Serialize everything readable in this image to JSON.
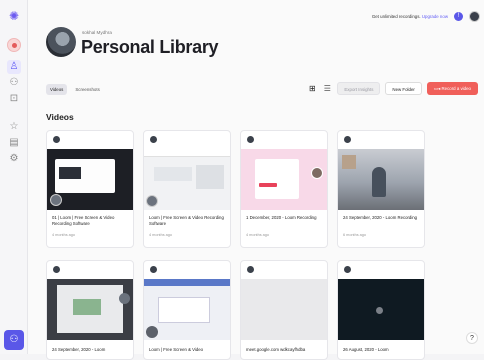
{
  "topbar": {
    "promo_text": "Get unlimited recordings.",
    "upgrade_link": "Upgrade now"
  },
  "header": {
    "username": "sokhal Mydhra",
    "title": "Personal Library"
  },
  "tabs": [
    {
      "label": "Videos",
      "active": true
    },
    {
      "label": "Screenshots",
      "active": false
    }
  ],
  "actions": {
    "export_insights": "Export Insights",
    "new_folder": "New Folder",
    "record_video": "Record a video"
  },
  "section_title": "Videos",
  "videos": [
    {
      "title": "01 | Loom | Free Screen & Video Recording Software",
      "meta": "4 months ago",
      "thumb": "dark"
    },
    {
      "title": "Loom | Free Screen & Video Recording Software",
      "meta": "4 months ago",
      "thumb": "light"
    },
    {
      "title": "1 December, 2020 - Loom Recording",
      "meta": "4 months ago",
      "thumb": "form"
    },
    {
      "title": "24 September, 2020 - Loom Recording",
      "meta": "6 months ago",
      "thumb": "room"
    },
    {
      "title": "24 September, 2020 - Loom",
      "meta": "",
      "thumb": "slide"
    },
    {
      "title": "Loom | Free Screen & Video",
      "meta": "",
      "thumb": "editor"
    },
    {
      "title": "meet.google.com wdkcayfhdba",
      "meta": "",
      "thumb": "blank"
    },
    {
      "title": "26 August, 2020 - Loom",
      "meta": "",
      "thumb": "night"
    }
  ],
  "accent_color": "#625df5",
  "record_color": "#f05f5a"
}
